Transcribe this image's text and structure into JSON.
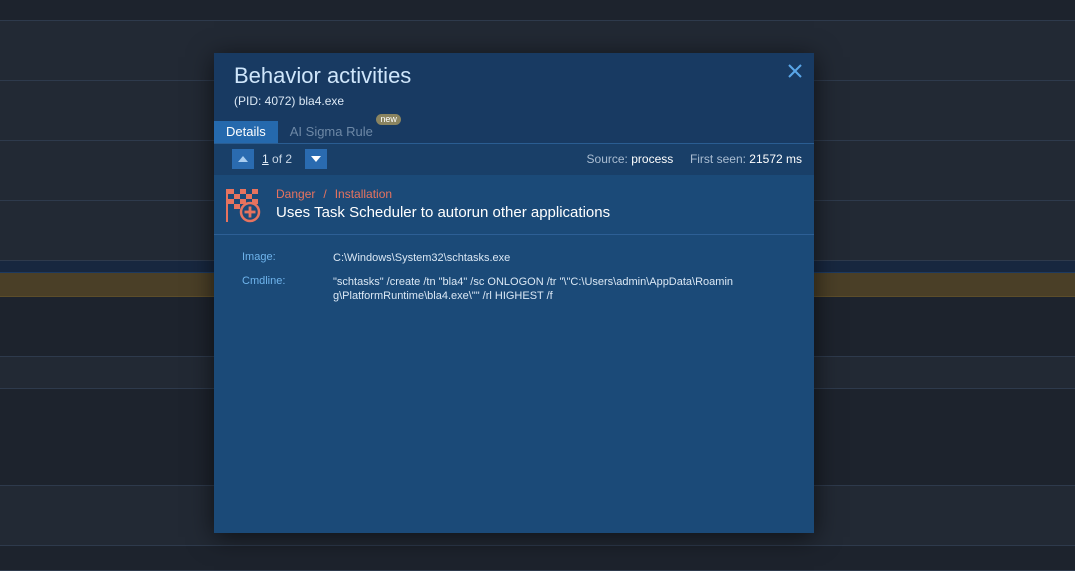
{
  "modal": {
    "title": "Behavior activities",
    "subtitle": "(PID: 4072) bla4.exe",
    "tabs": [
      {
        "label": "Details",
        "active": true
      },
      {
        "label": "AI Sigma Rule",
        "badge": "new",
        "active": false
      }
    ]
  },
  "pager": {
    "current": "1",
    "of_text": "of 2",
    "source_label": "Source:",
    "source_value": "process",
    "first_seen_label": "First seen:",
    "first_seen_value": "21572 ms"
  },
  "alert": {
    "level": "Danger",
    "separator": "/",
    "category": "Installation",
    "description": "Uses Task Scheduler to autorun other applications",
    "icon": "checkered-flag-plus-icon",
    "color": "#e7735f"
  },
  "details": [
    {
      "label": "Image:",
      "value": "C:\\Windows\\System32\\schtasks.exe"
    },
    {
      "label": "Cmdline:",
      "value": "\"schtasks\" /create /tn \"bla4\" /sc ONLOGON /tr \"\\\"C:\\Users\\admin\\AppData\\Roaming\\PlatformRuntime\\bla4.exe\\\"\" /rl HIGHEST /f"
    }
  ]
}
